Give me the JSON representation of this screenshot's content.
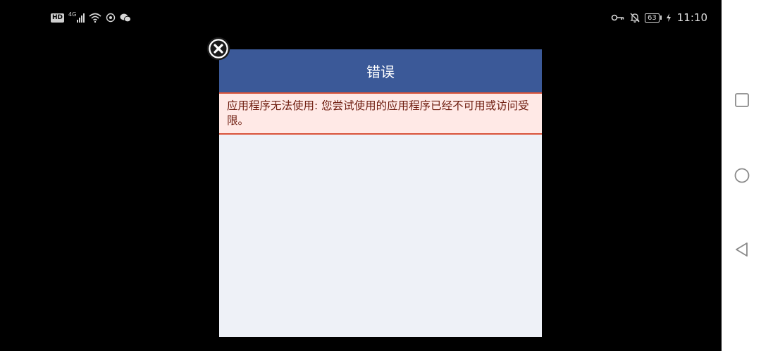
{
  "status_bar": {
    "hd_badge": "HD",
    "network": "4G",
    "battery_level": "63",
    "time": "11:10",
    "icons": [
      "hd-icon",
      "signal-icon",
      "wifi-icon",
      "sync-icon",
      "wechat-icon",
      "key-icon",
      "bell-off-icon",
      "battery-icon",
      "charging-icon"
    ]
  },
  "dialog": {
    "title": "错误",
    "error_message": "应用程序无法使用: 您尝试使用的应用程序已经不可用或访问受限。",
    "close_icon": "close-circle-icon"
  },
  "nav_bar": {
    "buttons": [
      "recent-apps-icon",
      "home-icon",
      "back-icon"
    ]
  },
  "colors": {
    "header": "#3b5998",
    "error_bg": "#ffe9e6",
    "error_border": "#d9533a",
    "error_text": "#6e1c0e",
    "dialog_bg": "#eef1f7"
  }
}
